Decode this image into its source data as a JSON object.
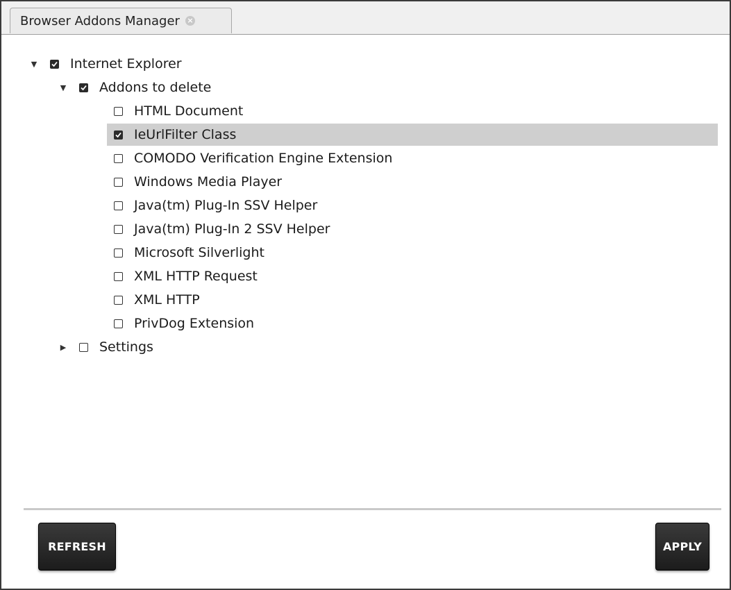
{
  "tab": {
    "title": "Browser Addons Manager",
    "close_icon": "close-icon"
  },
  "tree": {
    "root": {
      "label": "Internet Explorer",
      "expanded": true,
      "checked": true
    },
    "group": {
      "label": "Addons to delete",
      "expanded": true,
      "checked": true
    },
    "addons": [
      {
        "label": "HTML Document",
        "checked": false,
        "selected": false
      },
      {
        "label": "IeUrlFilter Class",
        "checked": true,
        "selected": true
      },
      {
        "label": "COMODO Verification Engine Extension",
        "checked": false,
        "selected": false
      },
      {
        "label": "Windows Media Player",
        "checked": false,
        "selected": false
      },
      {
        "label": "Java(tm) Plug-In SSV Helper",
        "checked": false,
        "selected": false
      },
      {
        "label": "Java(tm) Plug-In 2 SSV Helper",
        "checked": false,
        "selected": false
      },
      {
        "label": "Microsoft Silverlight",
        "checked": false,
        "selected": false
      },
      {
        "label": "XML HTTP Request",
        "checked": false,
        "selected": false
      },
      {
        "label": "XML HTTP",
        "checked": false,
        "selected": false
      },
      {
        "label": "PrivDog Extension",
        "checked": false,
        "selected": false
      }
    ],
    "settings": {
      "label": "Settings",
      "expanded": false,
      "checked": false
    }
  },
  "buttons": {
    "refresh_label": "REFRESH",
    "apply_label": "APPLY"
  }
}
